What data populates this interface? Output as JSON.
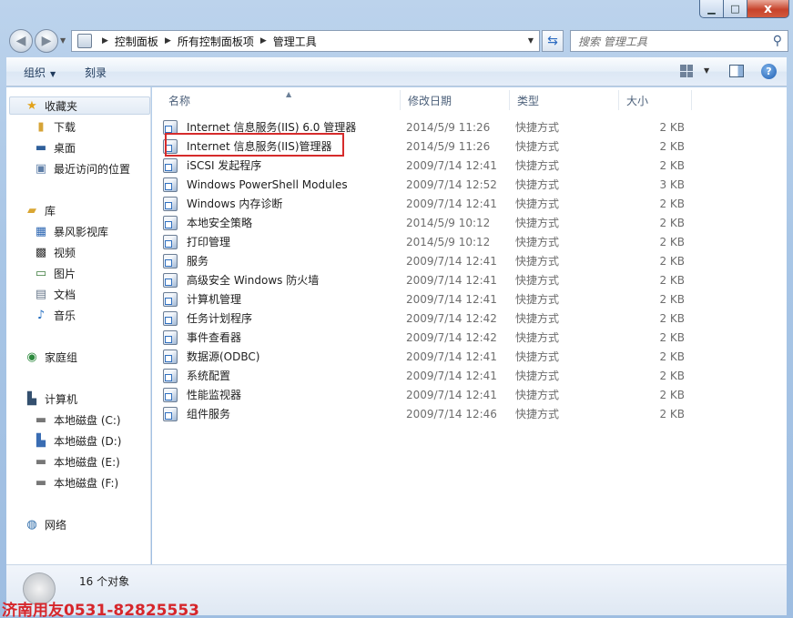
{
  "window": {
    "min_label": "▁",
    "max_label": "□",
    "close_label": "x"
  },
  "address": {
    "crumbs": [
      "控制面板",
      "所有控制面板项",
      "管理工具"
    ],
    "search_placeholder": "搜索 管理工具"
  },
  "toolbar": {
    "organize_label": "组织",
    "burn_label": "刻录",
    "help_label": "?"
  },
  "nav_pane": {
    "favorites": {
      "label": "收藏夹",
      "items": [
        "下载",
        "桌面",
        "最近访问的位置"
      ]
    },
    "libraries": {
      "label": "库",
      "items": [
        "暴风影视库",
        "视频",
        "图片",
        "文档",
        "音乐"
      ]
    },
    "homegroup": {
      "label": "家庭组"
    },
    "computer": {
      "label": "计算机",
      "items": [
        "本地磁盘 (C:)",
        "本地磁盘 (D:)",
        "本地磁盘 (E:)",
        "本地磁盘 (F:)"
      ]
    },
    "network": {
      "label": "网络"
    }
  },
  "columns": {
    "name": "名称",
    "date": "修改日期",
    "type": "类型",
    "size": "大小"
  },
  "files": [
    {
      "name": "Internet 信息服务(IIS) 6.0 管理器",
      "date": "2014/5/9 11:26",
      "type": "快捷方式",
      "size": "2 KB"
    },
    {
      "name": "Internet 信息服务(IIS)管理器",
      "date": "2014/5/9 11:26",
      "type": "快捷方式",
      "size": "2 KB"
    },
    {
      "name": "iSCSI 发起程序",
      "date": "2009/7/14 12:41",
      "type": "快捷方式",
      "size": "2 KB"
    },
    {
      "name": "Windows PowerShell Modules",
      "date": "2009/7/14 12:52",
      "type": "快捷方式",
      "size": "3 KB"
    },
    {
      "name": "Windows 内存诊断",
      "date": "2009/7/14 12:41",
      "type": "快捷方式",
      "size": "2 KB"
    },
    {
      "name": "本地安全策略",
      "date": "2014/5/9 10:12",
      "type": "快捷方式",
      "size": "2 KB"
    },
    {
      "name": "打印管理",
      "date": "2014/5/9 10:12",
      "type": "快捷方式",
      "size": "2 KB"
    },
    {
      "name": "服务",
      "date": "2009/7/14 12:41",
      "type": "快捷方式",
      "size": "2 KB"
    },
    {
      "name": "高级安全 Windows 防火墙",
      "date": "2009/7/14 12:41",
      "type": "快捷方式",
      "size": "2 KB"
    },
    {
      "name": "计算机管理",
      "date": "2009/7/14 12:41",
      "type": "快捷方式",
      "size": "2 KB"
    },
    {
      "name": "任务计划程序",
      "date": "2009/7/14 12:42",
      "type": "快捷方式",
      "size": "2 KB"
    },
    {
      "name": "事件查看器",
      "date": "2009/7/14 12:42",
      "type": "快捷方式",
      "size": "2 KB"
    },
    {
      "name": "数据源(ODBC)",
      "date": "2009/7/14 12:41",
      "type": "快捷方式",
      "size": "2 KB"
    },
    {
      "name": "系统配置",
      "date": "2009/7/14 12:41",
      "type": "快捷方式",
      "size": "2 KB"
    },
    {
      "name": "性能监视器",
      "date": "2009/7/14 12:41",
      "type": "快捷方式",
      "size": "2 KB"
    },
    {
      "name": "组件服务",
      "date": "2009/7/14 12:46",
      "type": "快捷方式",
      "size": "2 KB"
    }
  ],
  "status": {
    "count": "16 个对象"
  },
  "watermark": "济南用友0531-82825553",
  "colors": {
    "highlight_box": "#d62b2b",
    "watermark": "#d6262b"
  }
}
